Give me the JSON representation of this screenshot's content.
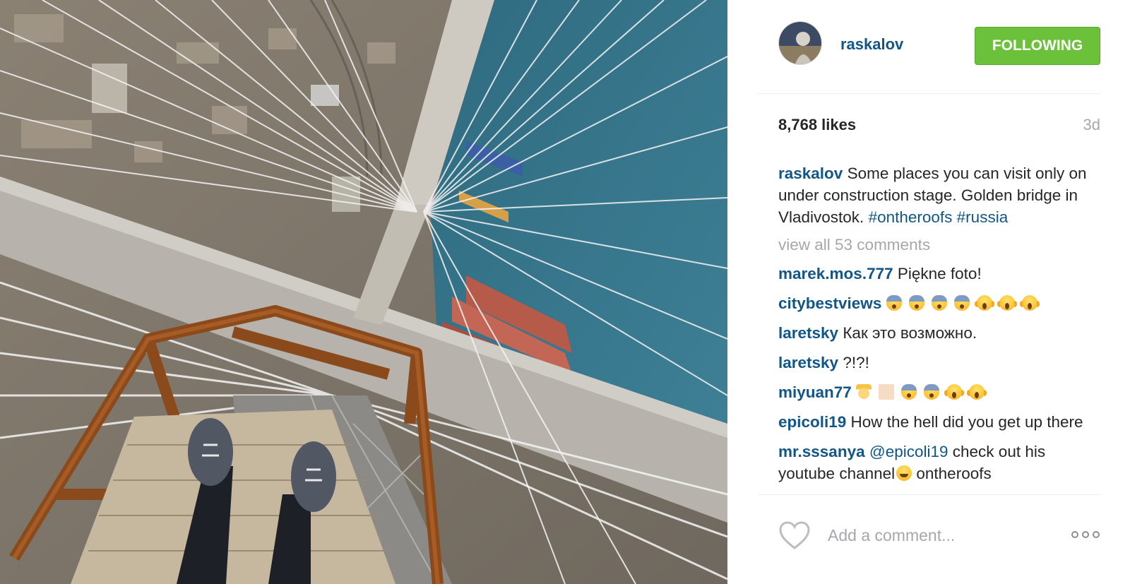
{
  "post": {
    "username": "raskalov",
    "follow_label": "FOLLOWING",
    "likes": "8,768 likes",
    "age": "3d",
    "caption_user": "raskalov",
    "caption_text": " Some places you can visit only on under construction stage. Golden bridge in Vladivostok. ",
    "hashtags": [
      "#ontheroofs",
      "#russia"
    ],
    "view_all": "view all 53 comments",
    "comments": [
      {
        "user": "marek.mos.777",
        "text": " Piękne foto!"
      },
      {
        "user": "citybestviews",
        "emojis": [
          "scared",
          "scared",
          "scared",
          "scared",
          "scream",
          "scream",
          "scream"
        ]
      },
      {
        "user": "laretsky",
        "text": " Как это возможно."
      },
      {
        "user": "laretsky",
        "text": " ?!?!"
      },
      {
        "user": "miyuan77",
        "emojis": [
          "prince",
          "skin",
          "scared",
          "scared",
          "scream",
          "scream"
        ]
      },
      {
        "user": "epicoli19",
        "text": " How the hell did you get up there"
      },
      {
        "user": "mr.sssanya",
        "text_before": " ",
        "mention": "@epicoli19",
        "text_after": " check out his youtube channel",
        "emoji": "laugh",
        "text_end": "  ontheroofs"
      }
    ],
    "comment_placeholder": "Add a comment...",
    "icons": {
      "like": "heart-outline-icon",
      "more": "ellipsis-icon"
    },
    "colors": {
      "link": "#125688",
      "follow": "#6bc23a",
      "muted": "#a5a7aa"
    }
  }
}
